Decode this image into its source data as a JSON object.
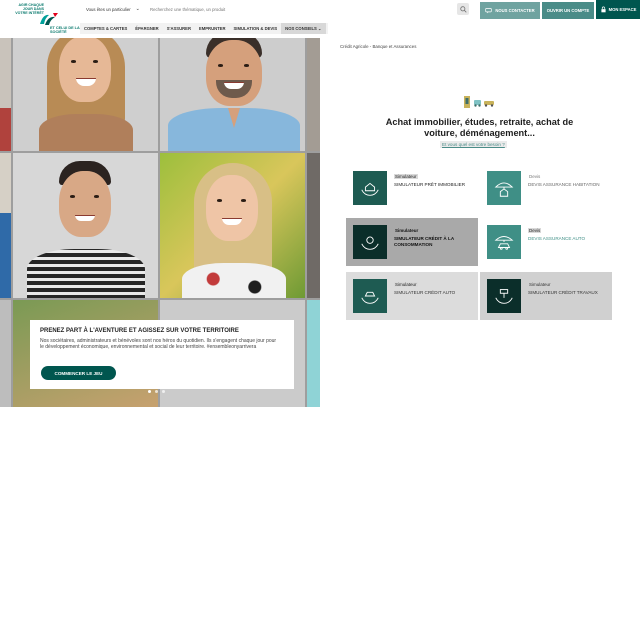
{
  "header": {
    "logo": {
      "tagline": "Agir chaque jour dans votre intérêt",
      "sub": "et celui de la société",
      "brand_mark": "CA"
    },
    "profile_select": "Vous êtes un particulier",
    "search_placeholder": "Recherchez une thématique, un produit",
    "contact_label": "Nous contacter",
    "open_account_label": "Ouvrir un compte",
    "my_space_label": "Mon espace",
    "nav": [
      "Comptes & cartes",
      "Épargner",
      "S'assurer",
      "Emprunter",
      "Simulation & devis",
      "Nos conseils"
    ]
  },
  "hero": {
    "promo_title": "Prenez part à l'aventure et agissez sur votre territoire",
    "promo_text": "Nos sociétaires, administrateurs et bénévoles sont nos héros du quotidien. Ils s'engagent chaque jour pour le développement économique, environnemental et social de leur territoire. #ensembleonyarrivera",
    "promo_button": "Commencer le jeu",
    "slides": 3,
    "active_slide": 1
  },
  "panel": {
    "breadcrumb": "Crédit Agricole - Banque et Assurances",
    "headline": "Achat immobilier, études, retraite, achat de voiture, déménagement...",
    "help_link": "Et vous quel est votre besoin ?",
    "cards": [
      {
        "kind": "Simulateur",
        "label": "Simulateur prêt immobilier",
        "icon": "house-hands-icon"
      },
      {
        "kind": "Devis",
        "label": "Devis assurance habitation",
        "icon": "umbrella-house-icon"
      },
      {
        "kind": "Simulateur",
        "label": "Simulateur crédit à la consommation",
        "icon": "money-hands-icon"
      },
      {
        "kind": "Devis",
        "label": "Devis assurance auto",
        "icon": "umbrella-car-icon"
      },
      {
        "kind": "Simulateur",
        "label": "Simulateur crédit auto",
        "icon": "car-hands-icon"
      },
      {
        "kind": "Simulateur",
        "label": "Simulateur crédit travaux",
        "icon": "paint-hands-icon"
      }
    ]
  },
  "colors": {
    "brand_dark": "#00564f",
    "brand_teal": "#4a8c88",
    "brand_light": "#6fa3a0",
    "card_grey": "#a9a9a9",
    "card_light": "#dcdcdc"
  }
}
